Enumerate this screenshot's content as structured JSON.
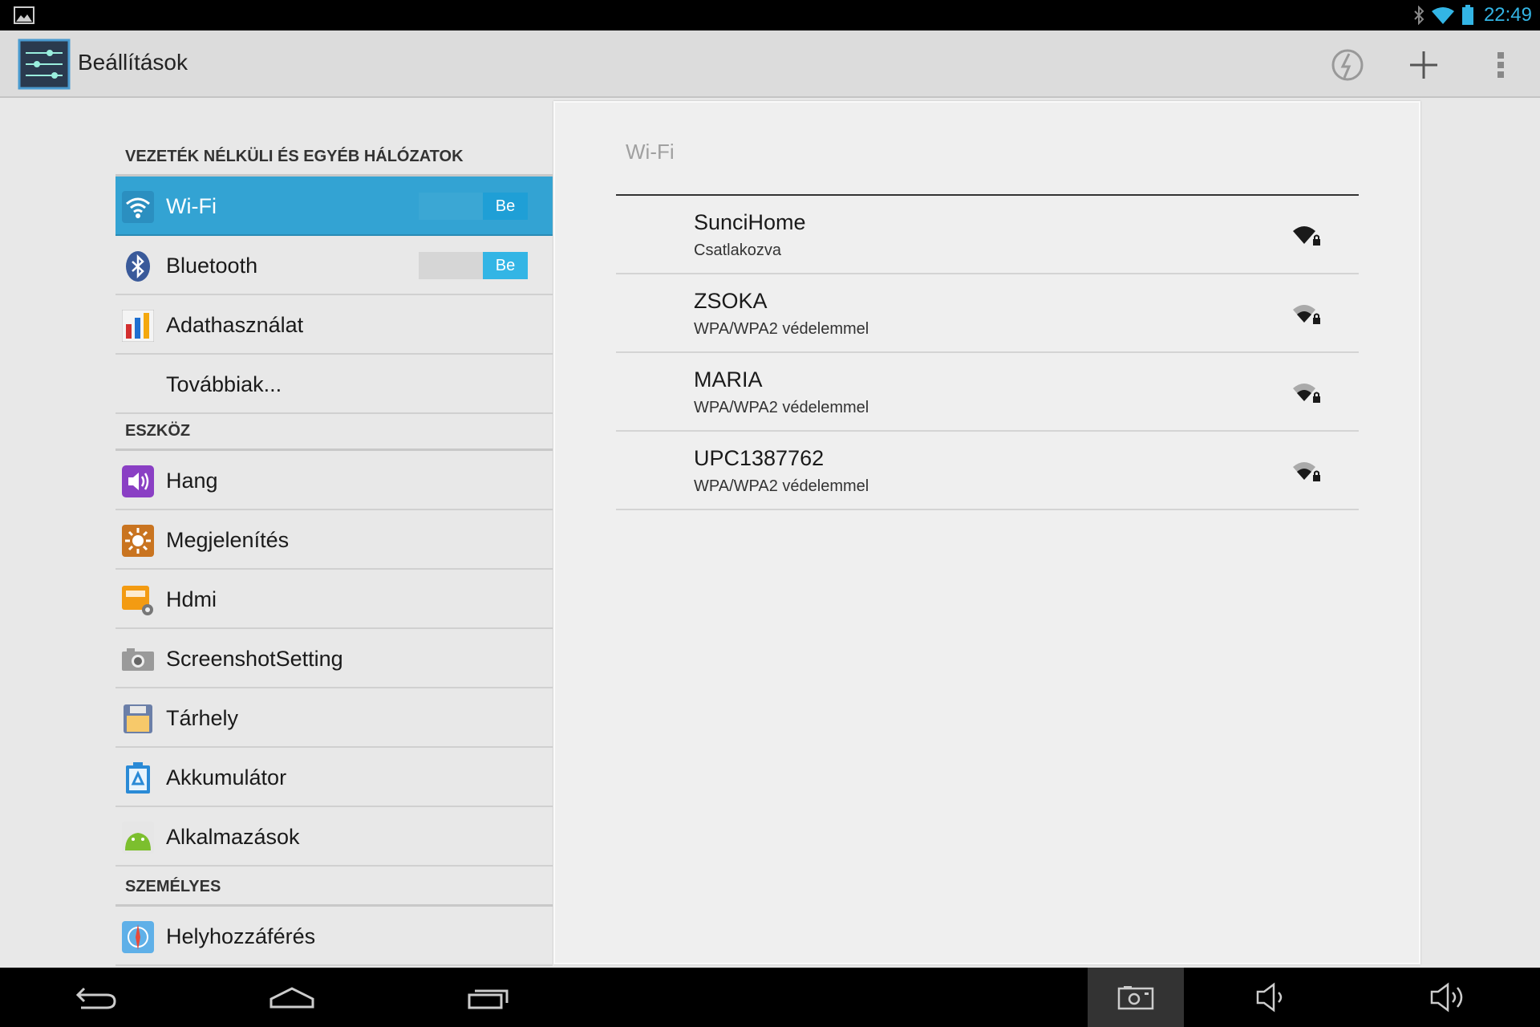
{
  "statusbar": {
    "icons": [
      "gallery-icon",
      "bluetooth-icon",
      "wifi-icon",
      "battery-icon"
    ],
    "time": "22:49",
    "accent": "#33b5e5"
  },
  "actionbar": {
    "title": "Beállítások",
    "actions": [
      "sync-icon",
      "add-icon",
      "overflow-menu-icon"
    ]
  },
  "sections": {
    "wireless": "VEZETÉK NÉLKÜLI ÉS EGYÉB HÁLÓZATOK",
    "device": "ESZKÖZ",
    "personal": "SZEMÉLYES"
  },
  "settings": {
    "wifi": {
      "label": "Wi-Fi",
      "toggle": "Be",
      "icon": "wifi-icon",
      "selected": true
    },
    "bluetooth": {
      "label": "Bluetooth",
      "toggle": "Be",
      "icon": "bluetooth-icon"
    },
    "data_usage": {
      "label": "Adathasználat",
      "icon": "data-usage-icon"
    },
    "more": {
      "label": "Továbbiak..."
    },
    "sound": {
      "label": "Hang",
      "icon": "sound-icon"
    },
    "display": {
      "label": "Megjelenítés",
      "icon": "display-icon"
    },
    "hdmi": {
      "label": "Hdmi",
      "icon": "hdmi-icon"
    },
    "screenshot": {
      "label": "ScreenshotSetting",
      "icon": "camera-icon"
    },
    "storage": {
      "label": "Tárhely",
      "icon": "storage-icon"
    },
    "battery": {
      "label": "Akkumulátor",
      "icon": "battery-settings-icon"
    },
    "apps": {
      "label": "Alkalmazások",
      "icon": "android-icon"
    },
    "location": {
      "label": "Helyhozzáférés",
      "icon": "location-icon"
    }
  },
  "wifi_panel": {
    "title": "Wi-Fi",
    "networks": [
      {
        "ssid": "SunciHome",
        "status": "Csatlakozva",
        "icon": "wifi-lock-icon"
      },
      {
        "ssid": "ZSOKA",
        "status": "WPA/WPA2 védelemmel",
        "icon": "wifi-lock-icon"
      },
      {
        "ssid": "MARIA",
        "status": "WPA/WPA2 védelemmel",
        "icon": "wifi-lock-icon"
      },
      {
        "ssid": "UPC1387762",
        "status": "WPA/WPA2 védelemmel",
        "icon": "wifi-lock-icon"
      }
    ]
  },
  "navbar": {
    "buttons": [
      "back-icon",
      "home-icon",
      "recent-apps-icon",
      "screenshot-icon",
      "volume-down-icon",
      "volume-up-icon"
    ]
  }
}
